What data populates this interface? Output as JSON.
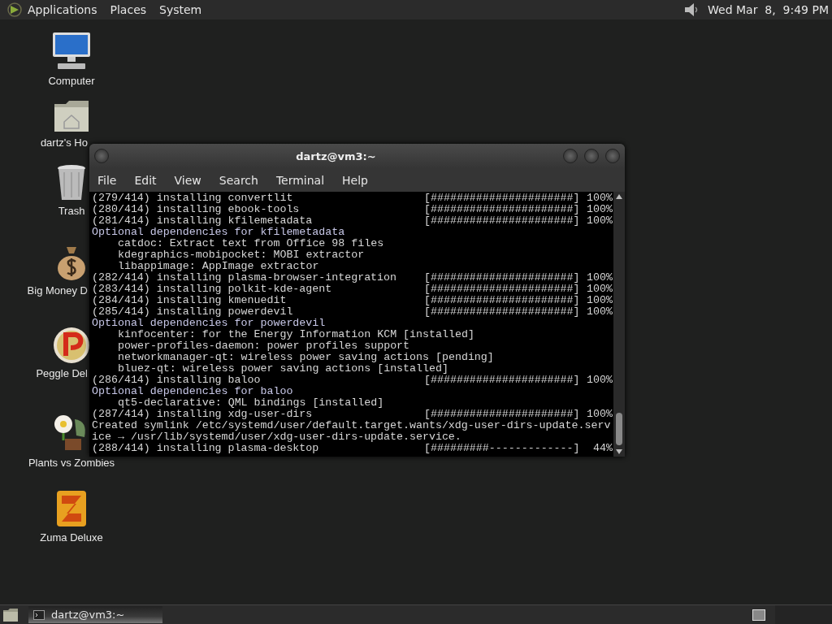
{
  "top_panel": {
    "menus": [
      "Applications",
      "Places",
      "System"
    ],
    "clock": "Wed Mar  8,  9:49 PM"
  },
  "desktop_icons": [
    {
      "kind": "computer",
      "label": "Computer"
    },
    {
      "kind": "home",
      "label": "dartz's Ho"
    },
    {
      "kind": "trash",
      "label": "Trash"
    },
    {
      "kind": "moneybag",
      "label": "Big Money D"
    },
    {
      "kind": "ball",
      "label": "Peggle Del"
    },
    {
      "kind": "flower",
      "label": "Plants vs Zombies"
    },
    {
      "kind": "block",
      "label": "Zuma Deluxe"
    }
  ],
  "terminal": {
    "title": "dartz@vm3:~",
    "menu": [
      "File",
      "Edit",
      "View",
      "Search",
      "Terminal",
      "Help"
    ],
    "lines": [
      {
        "kind": "install",
        "text": "(279/414) installing convertlit",
        "bar": "[######################]",
        "percent": "100%"
      },
      {
        "kind": "install",
        "text": "(280/414) installing ebook-tools",
        "bar": "[######################]",
        "percent": "100%"
      },
      {
        "kind": "install",
        "text": "(281/414) installing kfilemetadata",
        "bar": "[######################]",
        "percent": "100%"
      },
      {
        "kind": "header",
        "text": "Optional dependencies for kfilemetadata"
      },
      {
        "kind": "detail",
        "text": "catdoc: Extract text from Office 98 files"
      },
      {
        "kind": "detail",
        "text": "kdegraphics-mobipocket: MOBI extractor"
      },
      {
        "kind": "detail",
        "text": "libappimage: AppImage extractor"
      },
      {
        "kind": "install",
        "text": "(282/414) installing plasma-browser-integration",
        "bar": "[######################]",
        "percent": "100%"
      },
      {
        "kind": "install",
        "text": "(283/414) installing polkit-kde-agent",
        "bar": "[######################]",
        "percent": "100%"
      },
      {
        "kind": "install",
        "text": "(284/414) installing kmenuedit",
        "bar": "[######################]",
        "percent": "100%"
      },
      {
        "kind": "install",
        "text": "(285/414) installing powerdevil",
        "bar": "[######################]",
        "percent": "100%"
      },
      {
        "kind": "header",
        "text": "Optional dependencies for powerdevil"
      },
      {
        "kind": "detail",
        "text": "kinfocenter: for the Energy Information KCM [installed]"
      },
      {
        "kind": "detail",
        "text": "power-profiles-daemon: power profiles support"
      },
      {
        "kind": "detail",
        "text": "networkmanager-qt: wireless power saving actions [pending]"
      },
      {
        "kind": "detail",
        "text": "bluez-qt: wireless power saving actions [installed]"
      },
      {
        "kind": "install",
        "text": "(286/414) installing baloo",
        "bar": "[######################]",
        "percent": "100%"
      },
      {
        "kind": "header",
        "text": "Optional dependencies for baloo"
      },
      {
        "kind": "detail",
        "text": "qt5-declarative: QML bindings [installed]"
      },
      {
        "kind": "install",
        "text": "(287/414) installing xdg-user-dirs",
        "bar": "[######################]",
        "percent": "100%"
      },
      {
        "kind": "plain",
        "text": "Created symlink /etc/systemd/user/default.target.wants/xdg-user-dirs-update.serv"
      },
      {
        "kind": "plain",
        "text": "ice → /usr/lib/systemd/user/xdg-user-dirs-update.service."
      },
      {
        "kind": "install",
        "text": "(288/414) installing plasma-desktop",
        "bar": "[#########-------------]",
        "percent": "44%"
      }
    ]
  },
  "taskbar": {
    "tasks": [
      {
        "label": "dartz@vm3:~",
        "selected": true
      }
    ]
  }
}
